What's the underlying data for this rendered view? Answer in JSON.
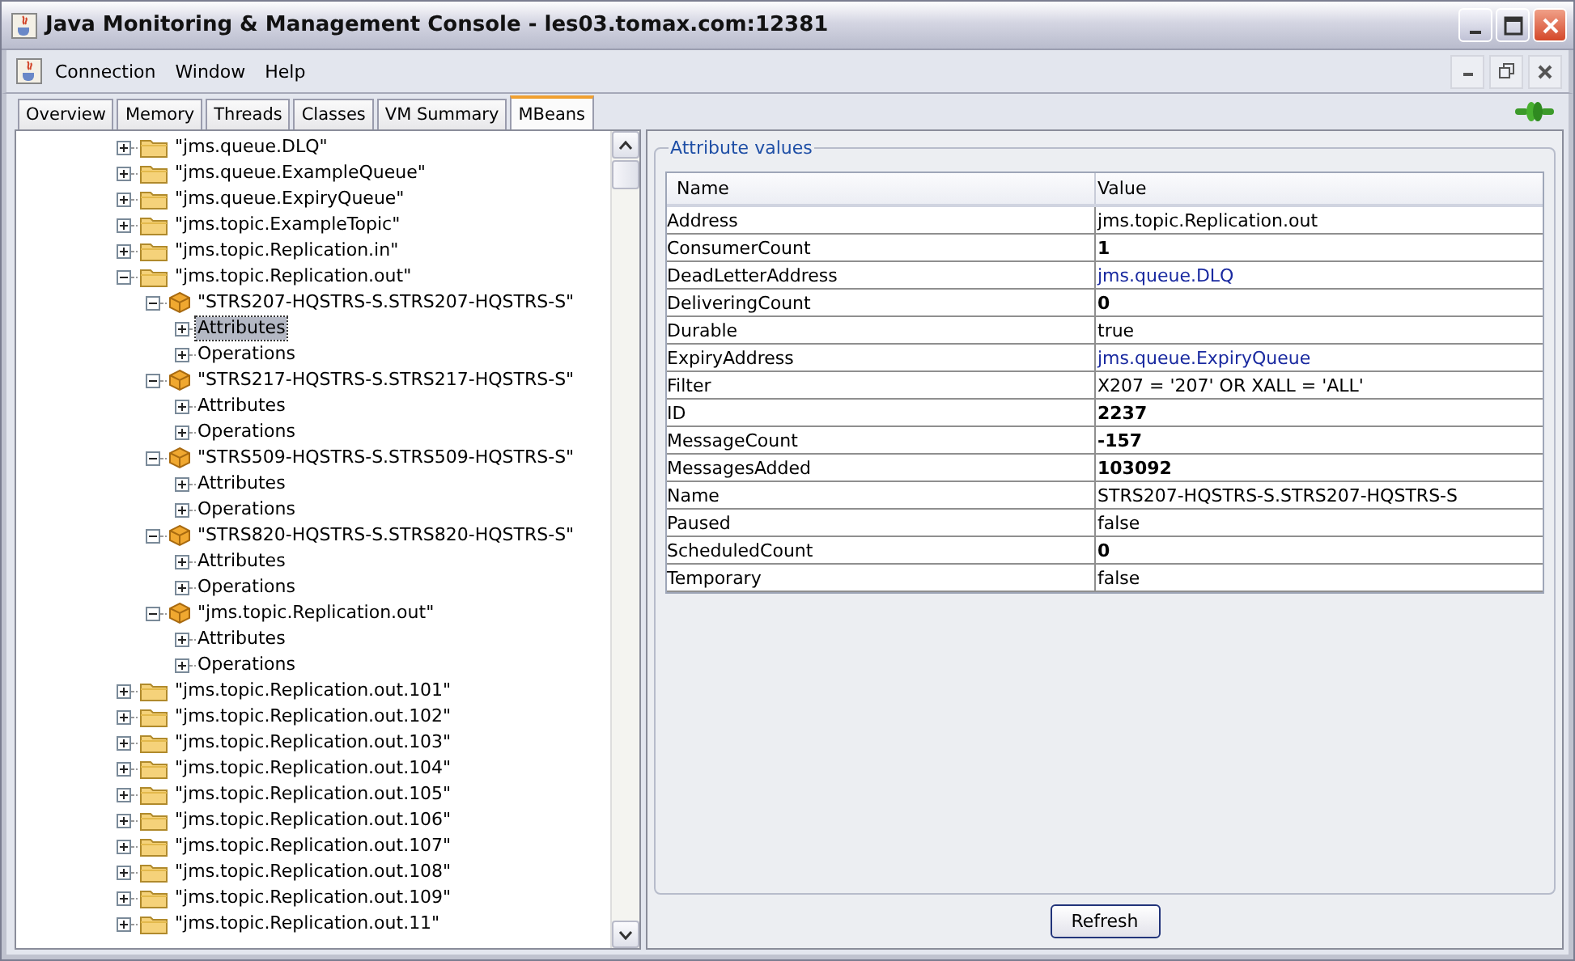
{
  "window": {
    "title": "Java Monitoring & Management Console - les03.tomax.com:12381"
  },
  "menu": [
    "Connection",
    "Window",
    "Help"
  ],
  "tabs": [
    {
      "label": "Overview",
      "selected": false
    },
    {
      "label": "Memory",
      "selected": false
    },
    {
      "label": "Threads",
      "selected": false
    },
    {
      "label": "Classes",
      "selected": false
    },
    {
      "label": "VM Summary",
      "selected": false
    },
    {
      "label": "MBeans",
      "selected": true
    }
  ],
  "tree": [
    {
      "label": "\"jms.queue.DLQ\"",
      "kind": "folder",
      "expanded": false,
      "selected": false
    },
    {
      "label": "\"jms.queue.ExampleQueue\"",
      "kind": "folder",
      "expanded": false,
      "selected": false
    },
    {
      "label": "\"jms.queue.ExpiryQueue\"",
      "kind": "folder",
      "expanded": false,
      "selected": false
    },
    {
      "label": "\"jms.topic.ExampleTopic\"",
      "kind": "folder",
      "expanded": false,
      "selected": false
    },
    {
      "label": "\"jms.topic.Replication.in\"",
      "kind": "folder",
      "expanded": false,
      "selected": false
    },
    {
      "label": "\"jms.topic.Replication.out\"",
      "kind": "folder",
      "expanded": true,
      "selected": false,
      "children": [
        {
          "label": "\"STRS207-HQSTRS-S.STRS207-HQSTRS-S\"",
          "kind": "bean",
          "expanded": true,
          "selected": false,
          "children": [
            {
              "label": "Attributes",
              "expanded": false,
              "selected": true
            },
            {
              "label": "Operations",
              "expanded": false,
              "selected": false
            }
          ]
        },
        {
          "label": "\"STRS217-HQSTRS-S.STRS217-HQSTRS-S\"",
          "kind": "bean",
          "expanded": true,
          "selected": false,
          "children": [
            {
              "label": "Attributes",
              "expanded": false,
              "selected": false
            },
            {
              "label": "Operations",
              "expanded": false,
              "selected": false
            }
          ]
        },
        {
          "label": "\"STRS509-HQSTRS-S.STRS509-HQSTRS-S\"",
          "kind": "bean",
          "expanded": true,
          "selected": false,
          "children": [
            {
              "label": "Attributes",
              "expanded": false,
              "selected": false
            },
            {
              "label": "Operations",
              "expanded": false,
              "selected": false
            }
          ]
        },
        {
          "label": "\"STRS820-HQSTRS-S.STRS820-HQSTRS-S\"",
          "kind": "bean",
          "expanded": true,
          "selected": false,
          "children": [
            {
              "label": "Attributes",
              "expanded": false,
              "selected": false
            },
            {
              "label": "Operations",
              "expanded": false,
              "selected": false
            }
          ]
        },
        {
          "label": "\"jms.topic.Replication.out\"",
          "kind": "bean",
          "expanded": true,
          "selected": false,
          "children": [
            {
              "label": "Attributes",
              "expanded": false,
              "selected": false
            },
            {
              "label": "Operations",
              "expanded": false,
              "selected": false
            }
          ]
        }
      ]
    },
    {
      "label": "\"jms.topic.Replication.out.101\"",
      "kind": "folder",
      "expanded": false,
      "selected": false
    },
    {
      "label": "\"jms.topic.Replication.out.102\"",
      "kind": "folder",
      "expanded": false,
      "selected": false
    },
    {
      "label": "\"jms.topic.Replication.out.103\"",
      "kind": "folder",
      "expanded": false,
      "selected": false
    },
    {
      "label": "\"jms.topic.Replication.out.104\"",
      "kind": "folder",
      "expanded": false,
      "selected": false
    },
    {
      "label": "\"jms.topic.Replication.out.105\"",
      "kind": "folder",
      "expanded": false,
      "selected": false
    },
    {
      "label": "\"jms.topic.Replication.out.106\"",
      "kind": "folder",
      "expanded": false,
      "selected": false
    },
    {
      "label": "\"jms.topic.Replication.out.107\"",
      "kind": "folder",
      "expanded": false,
      "selected": false
    },
    {
      "label": "\"jms.topic.Replication.out.108\"",
      "kind": "folder",
      "expanded": false,
      "selected": false
    },
    {
      "label": "\"jms.topic.Replication.out.109\"",
      "kind": "folder",
      "expanded": false,
      "selected": false
    },
    {
      "label": "\"jms.topic.Replication.out.11\"",
      "kind": "folder",
      "expanded": false,
      "selected": false
    }
  ],
  "attributes": {
    "title": "Attribute values",
    "columns": [
      "Name",
      "Value"
    ],
    "rows": [
      {
        "name": "Address",
        "value": "jms.topic.Replication.out",
        "kind": "text"
      },
      {
        "name": "ConsumerCount",
        "value": "1",
        "kind": "number"
      },
      {
        "name": "DeadLetterAddress",
        "value": "jms.queue.DLQ",
        "kind": "link"
      },
      {
        "name": "DeliveringCount",
        "value": "0",
        "kind": "number"
      },
      {
        "name": "Durable",
        "value": "true",
        "kind": "text"
      },
      {
        "name": "ExpiryAddress",
        "value": "jms.queue.ExpiryQueue",
        "kind": "link"
      },
      {
        "name": "Filter",
        "value": "X207 = '207' OR XALL = 'ALL'",
        "kind": "text"
      },
      {
        "name": "ID",
        "value": "2237",
        "kind": "number"
      },
      {
        "name": "MessageCount",
        "value": "-157",
        "kind": "number"
      },
      {
        "name": "MessagesAdded",
        "value": "103092",
        "kind": "number"
      },
      {
        "name": "Name",
        "value": "STRS207-HQSTRS-S.STRS207-HQSTRS-S",
        "kind": "text"
      },
      {
        "name": "Paused",
        "value": "false",
        "kind": "text"
      },
      {
        "name": "ScheduledCount",
        "value": "0",
        "kind": "number"
      },
      {
        "name": "Temporary",
        "value": "false",
        "kind": "text"
      }
    ]
  },
  "refresh_button": "Refresh"
}
